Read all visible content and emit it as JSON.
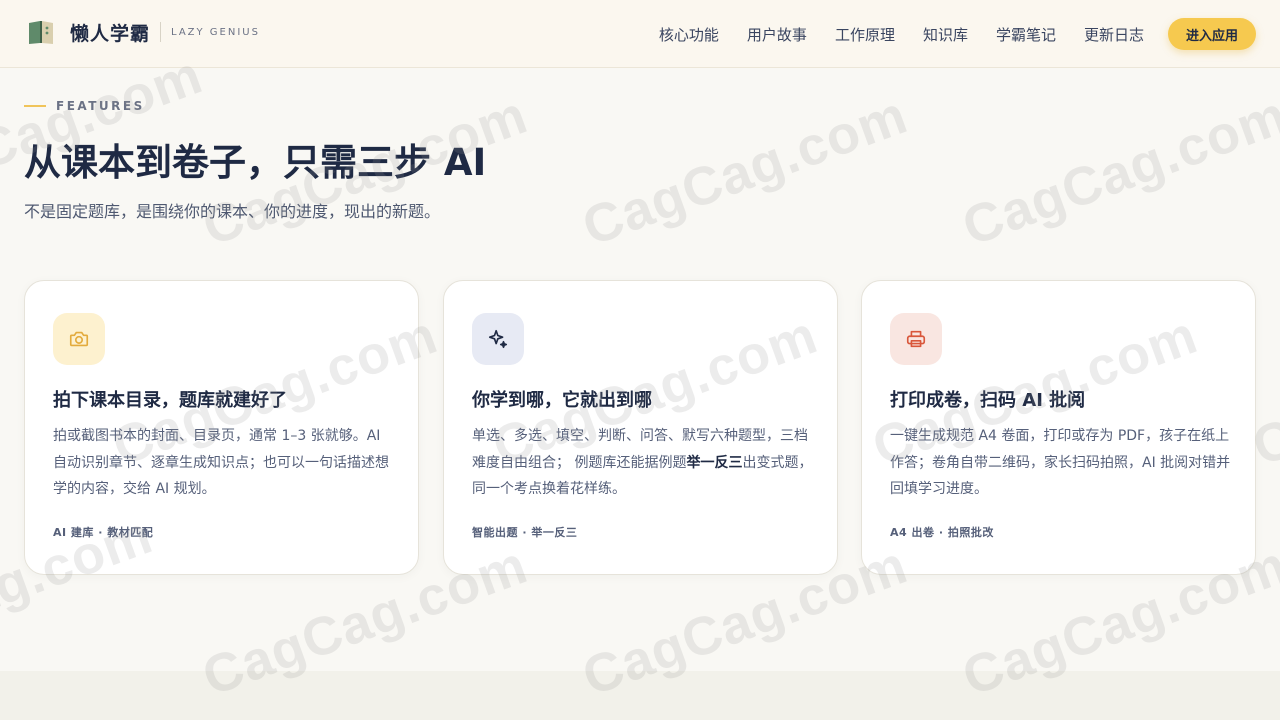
{
  "header": {
    "brand_name": "懒人学霸",
    "brand_sub": "LAZY GENIUS",
    "logo_icon": "book-icon",
    "nav": [
      "核心功能",
      "用户故事",
      "工作原理",
      "知识库",
      "学霸笔记",
      "更新日志"
    ],
    "cta_label": "进入应用"
  },
  "hero": {
    "eyebrow": "FEATURES",
    "title": "从课本到卷子，只需三步 AI",
    "subtitle": "不是固定题库，是围绕你的课本、你的进度，现出的新题。"
  },
  "cards": [
    {
      "icon": "camera-icon",
      "icon_bg": "#fdf1cf",
      "icon_color": "#e3ab3c",
      "title": "拍下课本目录，题库就建好了",
      "desc": "拍或截图书本的封面、目录页，通常 1–3 张就够。AI 自动识别章节、逐章生成知识点；也可以一句话描述想学的内容，交给 AI 规划。",
      "tag": "AI 建库 · 教材匹配"
    },
    {
      "icon": "sparkle-icon",
      "icon_bg": "#e7eaf4",
      "icon_color": "#1f2a44",
      "title": "你学到哪，它就出到哪",
      "desc_pre": "单选、多选、填空、判断、问答、默写六种题型，三档难度自由组合； 例题库还能据例题",
      "desc_bold": "举一反三",
      "desc_post": "出变式题，同一个考点换着花样练。",
      "tag": "智能出题 · 举一反三"
    },
    {
      "icon": "printer-icon",
      "icon_bg": "#f9e6e1",
      "icon_color": "#d9573b",
      "title": "打印成卷，扫码 AI 批阅",
      "desc": "一键生成规范 A4 卷面，打印或存为 PDF，孩子在纸上作答；卷角自带二维码，家长扫码拍照，AI 批阅对错并回填学习进度。",
      "tag": "A4 出卷 · 拍照批改"
    }
  ],
  "watermark": "CagCag.com"
}
